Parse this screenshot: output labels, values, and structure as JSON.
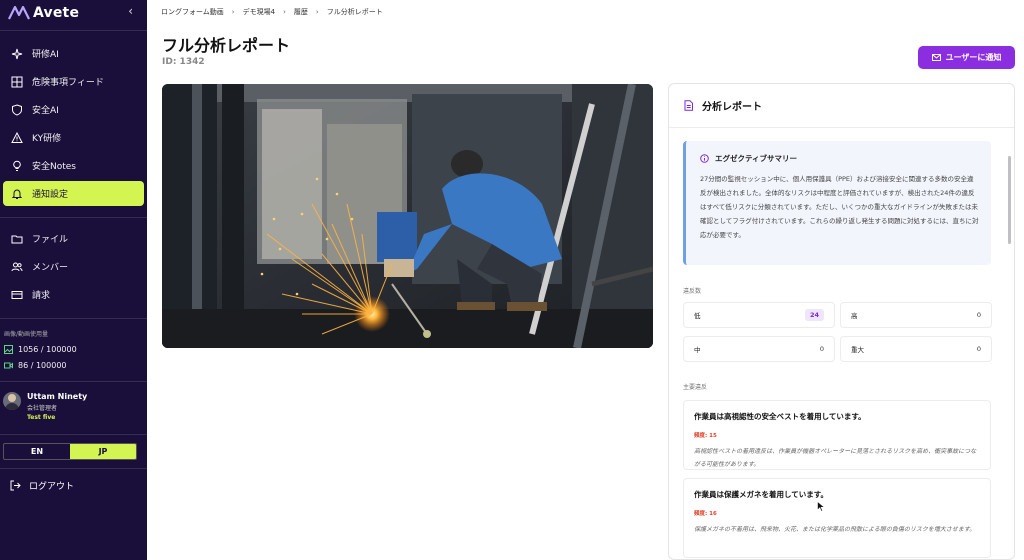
{
  "brand": {
    "name": "Avete"
  },
  "sidebar": {
    "items": [
      {
        "label": "研修AI",
        "icon": "sparkle-icon"
      },
      {
        "label": "危険事項フィード",
        "icon": "grid-icon"
      },
      {
        "label": "安全AI",
        "icon": "shield-icon"
      },
      {
        "label": "KY研修",
        "icon": "warning-icon"
      },
      {
        "label": "安全Notes",
        "icon": "lightbulb-icon"
      },
      {
        "label": "通知設定",
        "icon": "bell-icon",
        "active": true
      },
      {
        "label": "ファイル",
        "icon": "folder-icon"
      },
      {
        "label": "メンバー",
        "icon": "users-icon"
      },
      {
        "label": "請求",
        "icon": "card-icon"
      }
    ],
    "usage": {
      "title": "画像/動画使用量",
      "images": "1056 / 100000",
      "videos": "86 / 100000"
    },
    "user": {
      "name": "Uttam Ninety",
      "role": "会社管理者",
      "org": "Test five"
    },
    "lang": {
      "en": "EN",
      "jp": "JP",
      "selected": "JP"
    },
    "logout": "ログアウト"
  },
  "breadcrumb": [
    "ロングフォーム動画",
    "デモ現場4",
    "履歴",
    "フル分析レポート"
  ],
  "page": {
    "title": "フル分析レポート",
    "id": "ID: 1342",
    "notify_button": "ユーザーに通知"
  },
  "report": {
    "title": "分析レポート",
    "summary_title": "エグゼクティブサマリー",
    "summary_text": "27分間の監視セッション中に、個人用保護具（PPE）および溶接安全に関連する多数の安全違反が検出されました。全体的なリスクは中程度と評価されていますが、検出された24件の違反はすべて低リスクに分類されています。ただし、いくつかの重大なガイドラインが失敗または未確認としてフラグ付けされています。これらの繰り返し発生する問題に対処するには、直ちに対応が必要です。",
    "violations_label": "違反数",
    "stats": [
      {
        "label": "低",
        "value": "24",
        "highlight": true
      },
      {
        "label": "高",
        "value": "0"
      },
      {
        "label": "中",
        "value": "0"
      },
      {
        "label": "重大",
        "value": "0"
      }
    ],
    "main_violations_label": "主要違反",
    "issues": [
      {
        "title": "作業員は高視認性の安全ベストを着用しています。",
        "count": "頻度: 15",
        "text": "高視認性ベストの着用違反は、作業員が機器オペレーターに見落とされるリスクを高め、衝突事故につながる可能性があります。"
      },
      {
        "title": "作業員は保護メガネを着用しています。",
        "count": "頻度: 16",
        "text": "保護メガネの不着用は、飛来物、火花、または化学薬品の飛散による眼の負傷のリスクを増大させます。"
      }
    ]
  },
  "colors": {
    "sidebar_bg": "#1a0f3a",
    "accent_lime": "#d4f451",
    "button_purple": "#8a2ee0",
    "badge_purple": "#7a2ad8",
    "summary_border": "#6fa0e6",
    "issue_count_red": "#e0412b"
  }
}
